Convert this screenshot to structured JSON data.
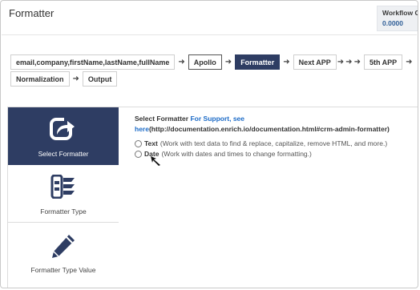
{
  "header": {
    "title": "Formatter",
    "workflow_label": "Workflow Co",
    "workflow_value": "0.0000"
  },
  "pipeline": {
    "row1": [
      "email,company,firstName,lastName,fullName",
      "Apollo",
      "Formatter",
      "Next APP",
      "5th APP"
    ],
    "row2": [
      "Normalization",
      "Output"
    ],
    "active_step": "Formatter"
  },
  "sidebar": {
    "items": [
      {
        "label": "Select Formatter",
        "icon": "share-arrow-icon",
        "active": true
      },
      {
        "label": "Formatter Type",
        "icon": "formatter-type-icon",
        "active": false
      },
      {
        "label": "Formatter Type Value",
        "icon": "pencil-icon",
        "active": false
      }
    ]
  },
  "main": {
    "heading": "Select Formatter",
    "support_text": "For Support, see",
    "support_link_text": "here",
    "support_url": "(http://documentation.enrich.io/documentation.html#crm-admin-formatter)",
    "options": [
      {
        "name": "Text",
        "desc": "(Work with text data to find & replace, capitalize, remove HTML, and more.)",
        "selected": false
      },
      {
        "name": "Date",
        "desc": "(Work with dates and times to change formatting.)",
        "selected": false
      }
    ]
  },
  "colors": {
    "accent_dark": "#2e3d63",
    "link": "#1c6bc7",
    "workflow_value": "#2f5e97"
  }
}
